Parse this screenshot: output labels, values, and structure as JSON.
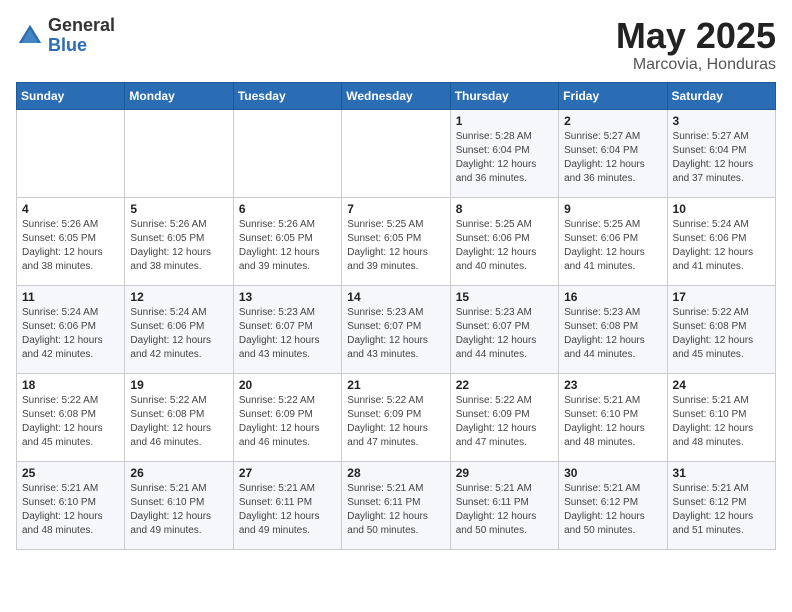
{
  "logo": {
    "general": "General",
    "blue": "Blue"
  },
  "title": "May 2025",
  "location": "Marcovia, Honduras",
  "days_of_week": [
    "Sunday",
    "Monday",
    "Tuesday",
    "Wednesday",
    "Thursday",
    "Friday",
    "Saturday"
  ],
  "weeks": [
    [
      {
        "day": "",
        "detail": ""
      },
      {
        "day": "",
        "detail": ""
      },
      {
        "day": "",
        "detail": ""
      },
      {
        "day": "",
        "detail": ""
      },
      {
        "day": "1",
        "detail": "Sunrise: 5:28 AM\nSunset: 6:04 PM\nDaylight: 12 hours\nand 36 minutes."
      },
      {
        "day": "2",
        "detail": "Sunrise: 5:27 AM\nSunset: 6:04 PM\nDaylight: 12 hours\nand 36 minutes."
      },
      {
        "day": "3",
        "detail": "Sunrise: 5:27 AM\nSunset: 6:04 PM\nDaylight: 12 hours\nand 37 minutes."
      }
    ],
    [
      {
        "day": "4",
        "detail": "Sunrise: 5:26 AM\nSunset: 6:05 PM\nDaylight: 12 hours\nand 38 minutes."
      },
      {
        "day": "5",
        "detail": "Sunrise: 5:26 AM\nSunset: 6:05 PM\nDaylight: 12 hours\nand 38 minutes."
      },
      {
        "day": "6",
        "detail": "Sunrise: 5:26 AM\nSunset: 6:05 PM\nDaylight: 12 hours\nand 39 minutes."
      },
      {
        "day": "7",
        "detail": "Sunrise: 5:25 AM\nSunset: 6:05 PM\nDaylight: 12 hours\nand 39 minutes."
      },
      {
        "day": "8",
        "detail": "Sunrise: 5:25 AM\nSunset: 6:06 PM\nDaylight: 12 hours\nand 40 minutes."
      },
      {
        "day": "9",
        "detail": "Sunrise: 5:25 AM\nSunset: 6:06 PM\nDaylight: 12 hours\nand 41 minutes."
      },
      {
        "day": "10",
        "detail": "Sunrise: 5:24 AM\nSunset: 6:06 PM\nDaylight: 12 hours\nand 41 minutes."
      }
    ],
    [
      {
        "day": "11",
        "detail": "Sunrise: 5:24 AM\nSunset: 6:06 PM\nDaylight: 12 hours\nand 42 minutes."
      },
      {
        "day": "12",
        "detail": "Sunrise: 5:24 AM\nSunset: 6:06 PM\nDaylight: 12 hours\nand 42 minutes."
      },
      {
        "day": "13",
        "detail": "Sunrise: 5:23 AM\nSunset: 6:07 PM\nDaylight: 12 hours\nand 43 minutes."
      },
      {
        "day": "14",
        "detail": "Sunrise: 5:23 AM\nSunset: 6:07 PM\nDaylight: 12 hours\nand 43 minutes."
      },
      {
        "day": "15",
        "detail": "Sunrise: 5:23 AM\nSunset: 6:07 PM\nDaylight: 12 hours\nand 44 minutes."
      },
      {
        "day": "16",
        "detail": "Sunrise: 5:23 AM\nSunset: 6:08 PM\nDaylight: 12 hours\nand 44 minutes."
      },
      {
        "day": "17",
        "detail": "Sunrise: 5:22 AM\nSunset: 6:08 PM\nDaylight: 12 hours\nand 45 minutes."
      }
    ],
    [
      {
        "day": "18",
        "detail": "Sunrise: 5:22 AM\nSunset: 6:08 PM\nDaylight: 12 hours\nand 45 minutes."
      },
      {
        "day": "19",
        "detail": "Sunrise: 5:22 AM\nSunset: 6:08 PM\nDaylight: 12 hours\nand 46 minutes."
      },
      {
        "day": "20",
        "detail": "Sunrise: 5:22 AM\nSunset: 6:09 PM\nDaylight: 12 hours\nand 46 minutes."
      },
      {
        "day": "21",
        "detail": "Sunrise: 5:22 AM\nSunset: 6:09 PM\nDaylight: 12 hours\nand 47 minutes."
      },
      {
        "day": "22",
        "detail": "Sunrise: 5:22 AM\nSunset: 6:09 PM\nDaylight: 12 hours\nand 47 minutes."
      },
      {
        "day": "23",
        "detail": "Sunrise: 5:21 AM\nSunset: 6:10 PM\nDaylight: 12 hours\nand 48 minutes."
      },
      {
        "day": "24",
        "detail": "Sunrise: 5:21 AM\nSunset: 6:10 PM\nDaylight: 12 hours\nand 48 minutes."
      }
    ],
    [
      {
        "day": "25",
        "detail": "Sunrise: 5:21 AM\nSunset: 6:10 PM\nDaylight: 12 hours\nand 48 minutes."
      },
      {
        "day": "26",
        "detail": "Sunrise: 5:21 AM\nSunset: 6:10 PM\nDaylight: 12 hours\nand 49 minutes."
      },
      {
        "day": "27",
        "detail": "Sunrise: 5:21 AM\nSunset: 6:11 PM\nDaylight: 12 hours\nand 49 minutes."
      },
      {
        "day": "28",
        "detail": "Sunrise: 5:21 AM\nSunset: 6:11 PM\nDaylight: 12 hours\nand 50 minutes."
      },
      {
        "day": "29",
        "detail": "Sunrise: 5:21 AM\nSunset: 6:11 PM\nDaylight: 12 hours\nand 50 minutes."
      },
      {
        "day": "30",
        "detail": "Sunrise: 5:21 AM\nSunset: 6:12 PM\nDaylight: 12 hours\nand 50 minutes."
      },
      {
        "day": "31",
        "detail": "Sunrise: 5:21 AM\nSunset: 6:12 PM\nDaylight: 12 hours\nand 51 minutes."
      }
    ]
  ]
}
